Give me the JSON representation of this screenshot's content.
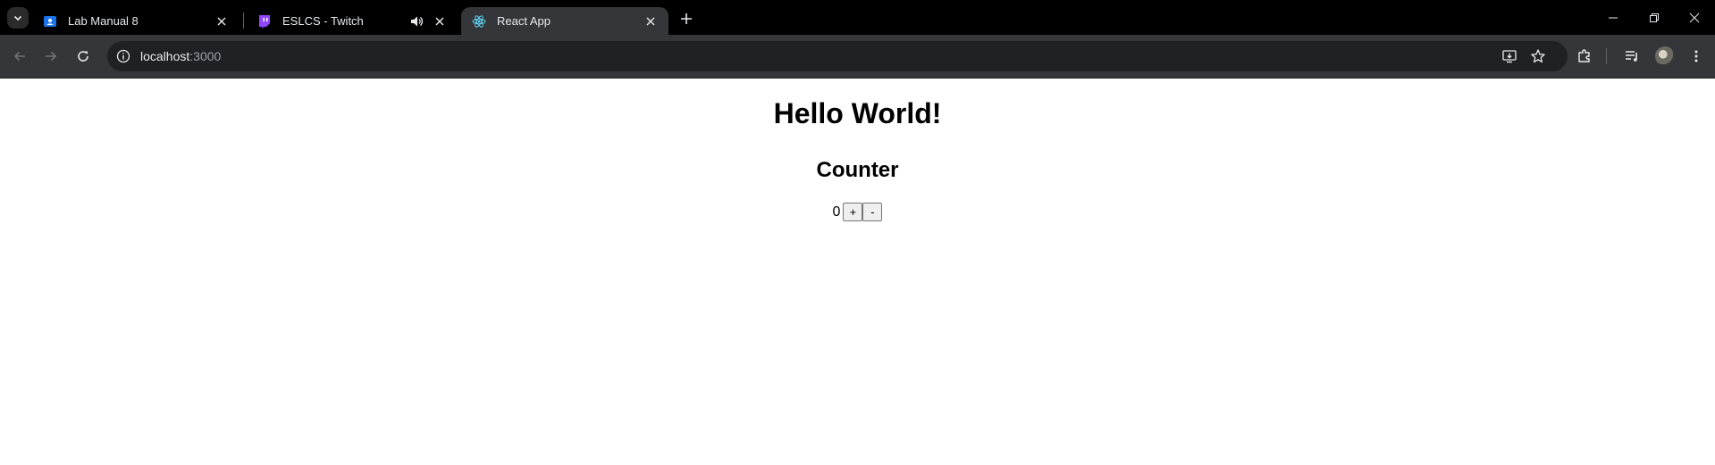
{
  "browser": {
    "tabs": [
      {
        "title": "Lab Manual 8",
        "icon": "google-classroom-icon",
        "active": false
      },
      {
        "title": "ESLCS - Twitch",
        "icon": "twitch-icon",
        "active": false,
        "audio": true
      },
      {
        "title": "React App",
        "icon": "react-icon",
        "active": true
      }
    ],
    "address": {
      "host": "localhost",
      "port": ":3000"
    },
    "colors": {
      "tabstrip": "#000000",
      "toolbar": "#35363a",
      "omnibox": "#202124",
      "active_tab": "#35363a"
    }
  },
  "page": {
    "heading": "Hello World!",
    "subheading": "Counter",
    "count": "0",
    "increment_label": "+",
    "decrement_label": "-"
  }
}
